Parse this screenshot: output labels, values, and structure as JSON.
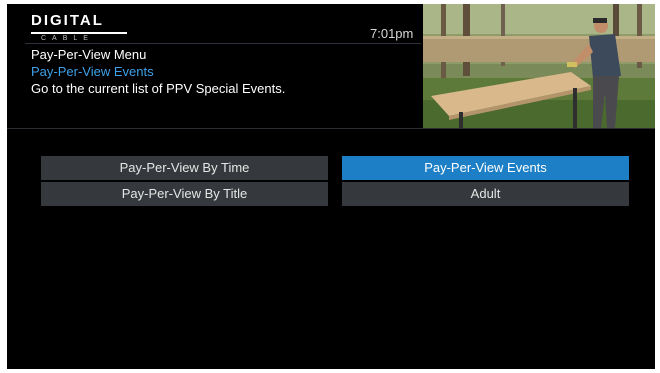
{
  "header": {
    "logo_main": "DIGITAL",
    "logo_sub": "CABLE",
    "time": "7:01pm",
    "menu_title": "Pay-Per-View Menu",
    "menu_selected": "Pay-Per-View Events",
    "menu_description": "Go to the current list of PPV Special Events."
  },
  "menu": {
    "by_time": "Pay-Per-View By Time",
    "events": "Pay-Per-View Events",
    "by_title": "Pay-Per-View By Title",
    "adult": "Adult"
  },
  "colors": {
    "background": "#000000",
    "accent": "#1d7fc6",
    "highlight_text": "#3fa0e8",
    "button": "#35383c"
  },
  "icons": {
    "logo": "digital-cable-logo",
    "preview": "live-tv-preview"
  }
}
